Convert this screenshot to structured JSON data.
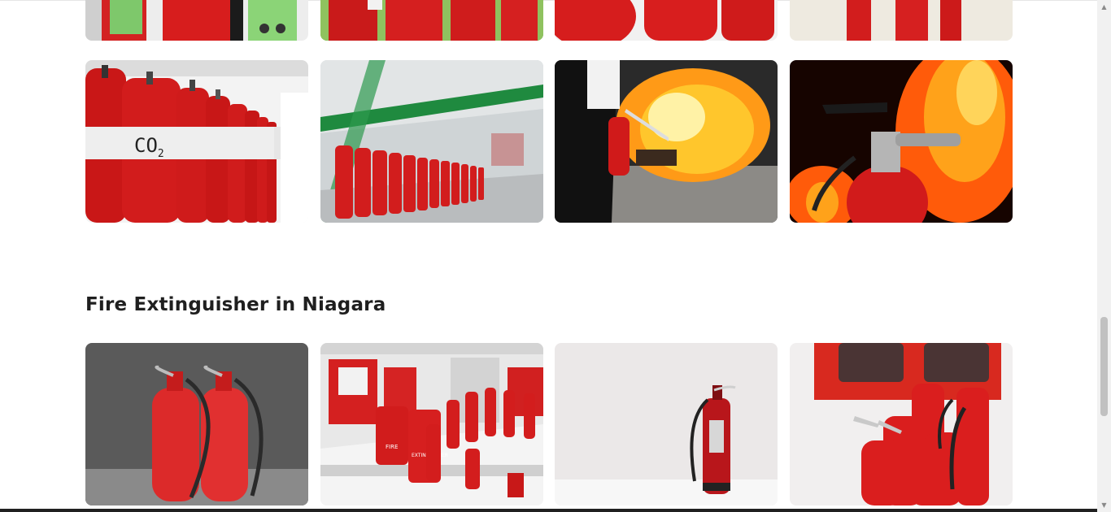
{
  "sections": [
    {
      "title": "",
      "images": [
        {
          "alt": "fire-extinguishers-green-labels"
        },
        {
          "alt": "fire-extinguishers-outdoor-row"
        },
        {
          "alt": "fire-extinguisher-cylinders-closeup"
        },
        {
          "alt": "fire-extinguishers-white-floor"
        },
        {
          "alt": "co2-cylinder-bank"
        },
        {
          "alt": "industrial-suppression-cylinders"
        },
        {
          "alt": "person-using-extinguisher-on-fire"
        },
        {
          "alt": "extinguisher-in-front-of-flames"
        }
      ]
    },
    {
      "title": "Fire Extinguisher in Niagara",
      "images": [
        {
          "alt": "two-red-extinguishers-grey-backdrop"
        },
        {
          "alt": "extinguisher-showroom-display"
        },
        {
          "alt": "single-extinguisher-white-room"
        },
        {
          "alt": "extinguishers-red-cabinet"
        }
      ]
    }
  ],
  "co2_label": "CO",
  "co2_sub": "2",
  "fire_text": [
    "FIRE",
    "EXTINGUISHER"
  ],
  "colors": {
    "extinguisher_red": "#d91b1b",
    "title_text": "#1f1f1f",
    "scrollbar_track": "#f1f1f1",
    "scrollbar_thumb": "#c1c1c1"
  }
}
